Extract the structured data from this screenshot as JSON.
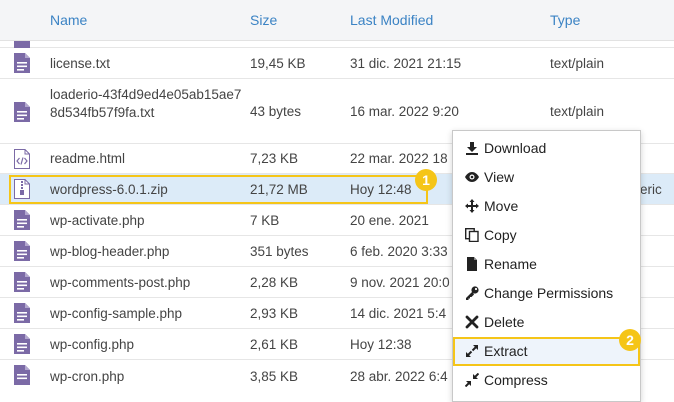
{
  "table": {
    "columns": {
      "name": "Name",
      "size": "Size",
      "modified": "Last Modified",
      "type": "Type"
    },
    "rows": [
      {
        "icon": "text-file-icon",
        "name": "license.txt",
        "size": "19,45 KB",
        "modified": "31 dic. 2021 21:15",
        "type": "text/plain"
      },
      {
        "icon": "text-file-icon",
        "name": "loaderio-43f4d9ed4e05ab15ae78d534fb57f9fa.txt",
        "size": "43 bytes",
        "modified": "16 mar. 2022 9:20",
        "type": "text/plain"
      },
      {
        "icon": "html-file-icon",
        "name": "readme.html",
        "size": "7,23 KB",
        "modified": "22 mar. 2022 18",
        "type": ""
      },
      {
        "icon": "zip-file-icon",
        "name": "wordpress-6.0.1.zip",
        "size": "21,72 MB",
        "modified": "Hoy 12:48",
        "type": "eric"
      },
      {
        "icon": "text-file-icon",
        "name": "wp-activate.php",
        "size": "7 KB",
        "modified": "20 ene. 2021",
        "type": ""
      },
      {
        "icon": "text-file-icon",
        "name": "wp-blog-header.php",
        "size": "351 bytes",
        "modified": "6 feb. 2020 3:33",
        "type": ""
      },
      {
        "icon": "text-file-icon",
        "name": "wp-comments-post.php",
        "size": "2,28 KB",
        "modified": "9 nov. 2021 20:0",
        "type": ""
      },
      {
        "icon": "text-file-icon",
        "name": "wp-config-sample.php",
        "size": "2,93 KB",
        "modified": "14 dic. 2021 5:4",
        "type": ""
      },
      {
        "icon": "text-file-icon",
        "name": "wp-config.php",
        "size": "2,61 KB",
        "modified": "Hoy 12:38",
        "type": ""
      },
      {
        "icon": "text-file-icon",
        "name": "wp-cron.php",
        "size": "3,85 KB",
        "modified": "28 abr. 2022 6:4",
        "type": ""
      }
    ]
  },
  "badges": {
    "first": "1",
    "second": "2"
  },
  "context_menu": {
    "items": [
      {
        "icon": "download-icon",
        "label": "Download"
      },
      {
        "icon": "eye-icon",
        "label": "View"
      },
      {
        "icon": "move-icon",
        "label": "Move"
      },
      {
        "icon": "copy-icon",
        "label": "Copy"
      },
      {
        "icon": "rename-icon",
        "label": "Rename"
      },
      {
        "icon": "key-icon",
        "label": "Change Permissions"
      },
      {
        "icon": "delete-icon",
        "label": "Delete"
      },
      {
        "icon": "extract-icon",
        "label": "Extract"
      },
      {
        "icon": "compress-icon",
        "label": "Compress"
      }
    ]
  },
  "colors": {
    "accent": "#3b83c4",
    "highlight": "#f5c518",
    "selected_row": "#dcebf8",
    "icon": "#7b6aa6"
  }
}
